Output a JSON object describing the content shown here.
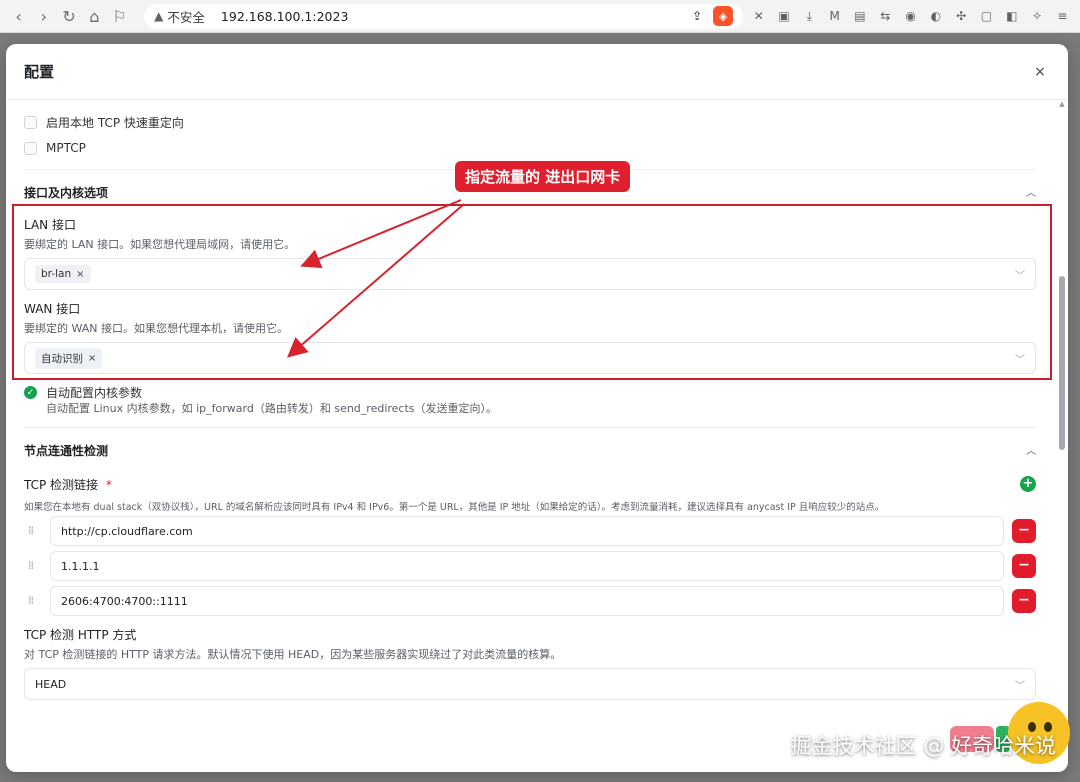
{
  "browser": {
    "insecure_label": "不安全",
    "url": "192.168.100.1:2023"
  },
  "dialog": {
    "title": "配置",
    "close": "×"
  },
  "checks": {
    "tcp_redirect": "启用本地 TCP 快速重定向",
    "mptcp": "MPTCP",
    "auto_kernel": "自动配置内核参数",
    "auto_kernel_desc": "自动配置 Linux 内核参数，如 ip_forward（路由转发）和 send_redirects（发送重定向）。"
  },
  "interface_section": {
    "title": "接口及内核选项",
    "lan_label": "LAN 接口",
    "lan_desc": "要绑定的 LAN 接口。如果您想代理局域网，请使用它。",
    "lan_value": "br-lan",
    "wan_label": "WAN 接口",
    "wan_desc": "要绑定的 WAN 接口。如果您想代理本机，请使用它。",
    "wan_value": "自动识别"
  },
  "annotation": {
    "callout": "指定流量的 进出口网卡",
    "color": "#e0202e"
  },
  "connectivity_section": {
    "title": "节点连通性检测",
    "tcp_check_label": "TCP 检测链接",
    "required_mark": "*",
    "tcp_check_desc": "如果您在本地有 dual stack（双协议栈），URL 的域名解析应该同时具有 IPv4 和 IPv6。第一个是 URL，其他是 IP 地址（如果给定的话）。考虑到流量消耗，建议选择具有 anycast IP 且响应较少的站点。",
    "urls": [
      "http://cp.cloudflare.com",
      "1.1.1.1",
      "2606:4700:4700::1111"
    ],
    "http_method_label": "TCP 检测 HTTP 方式",
    "http_method_desc": "对 TCP 检测链接的 HTTP 请求方法。默认情况下使用 HEAD，因为某些服务器实现绕过了对此类流量的核算。",
    "http_method_value": "HEAD"
  },
  "watermark": "掘金技术社区 @ 好奇哈米说",
  "colors": {
    "accent_green": "#17a34a",
    "danger_red": "#e11d2b"
  }
}
